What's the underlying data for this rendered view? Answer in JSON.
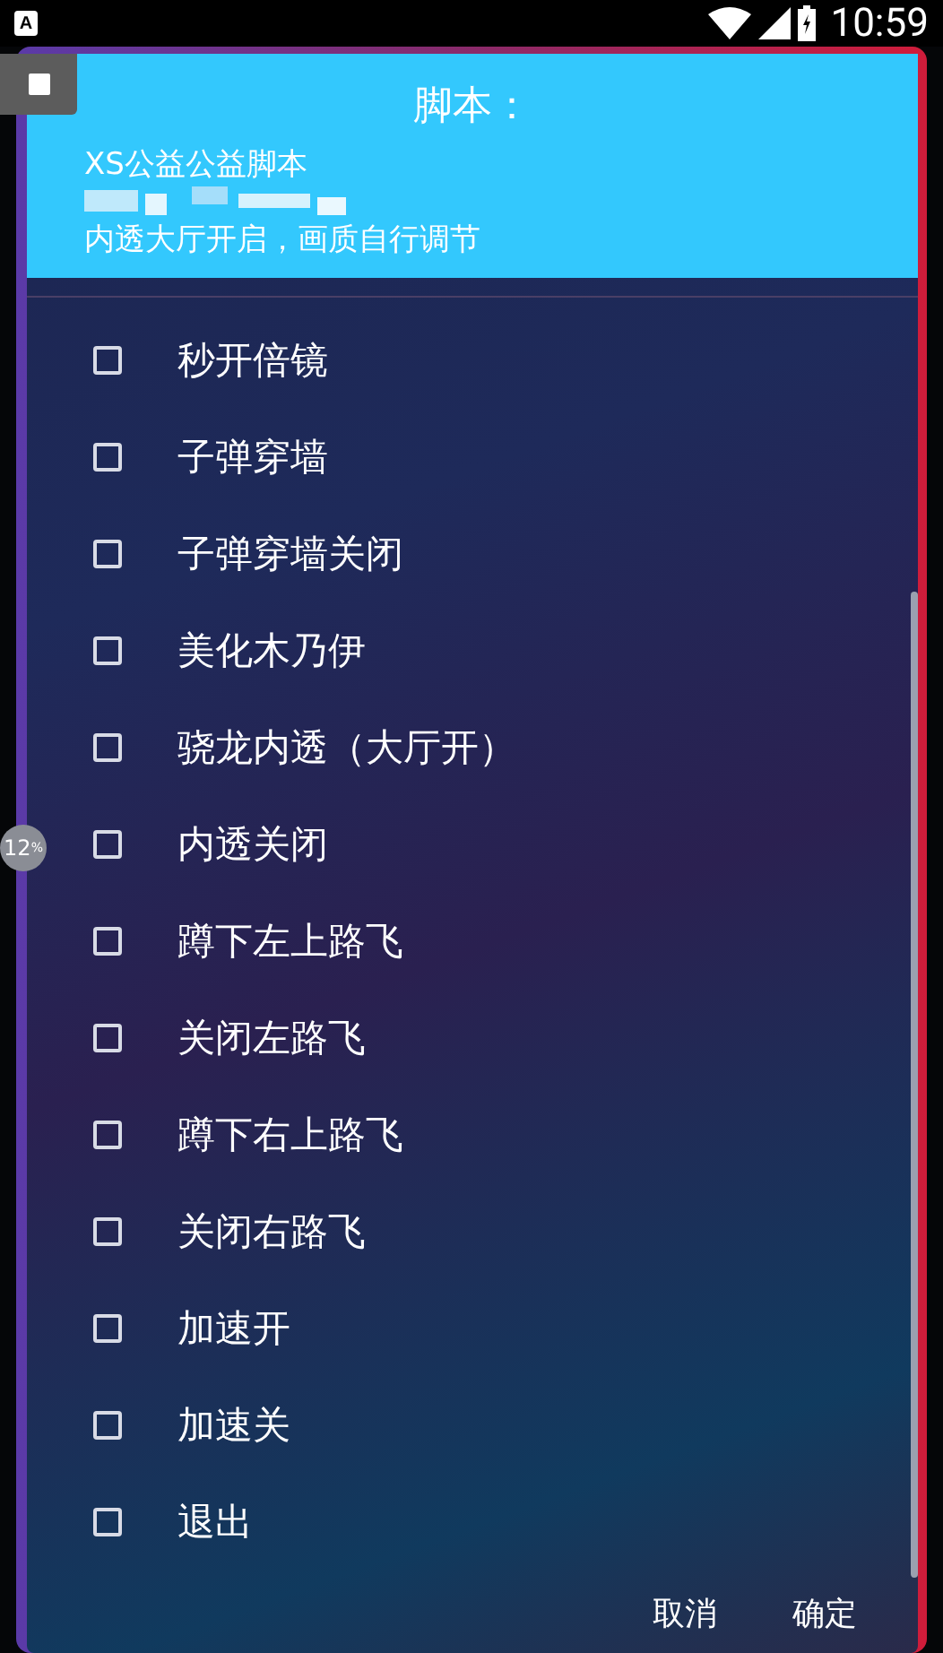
{
  "status_bar": {
    "app_icon": "A",
    "time": "10:59"
  },
  "dialog": {
    "title": "脚本：",
    "lines": [
      "XS公益公益脚本",
      "内透大厅开启，画质自行调节"
    ],
    "options": [
      {
        "label": "秒开倍镜",
        "checked": false
      },
      {
        "label": "子弹穿墙",
        "checked": false
      },
      {
        "label": "子弹穿墙关闭",
        "checked": false
      },
      {
        "label": "美化木乃伊",
        "checked": false
      },
      {
        "label": "骁龙内透（大厅开）",
        "checked": false
      },
      {
        "label": "内透关闭",
        "checked": false
      },
      {
        "label": "蹲下左上路飞",
        "checked": false
      },
      {
        "label": "关闭左路飞",
        "checked": false
      },
      {
        "label": "蹲下右上路飞",
        "checked": false
      },
      {
        "label": "关闭右路飞",
        "checked": false
      },
      {
        "label": "加速开",
        "checked": false
      },
      {
        "label": "加速关",
        "checked": false
      },
      {
        "label": "退出",
        "checked": false
      }
    ],
    "buttons": [
      "取消",
      "确定"
    ]
  },
  "progress_badge": {
    "text": "12$^{%}$"
  }
}
